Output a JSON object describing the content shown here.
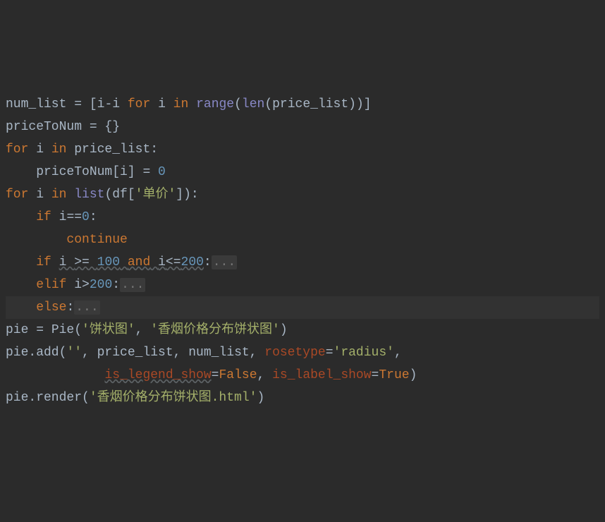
{
  "lines": {
    "l1": {
      "t1": "num_list ",
      "t2": "= [",
      "t3": "i",
      "t4": "-",
      "t5": "i ",
      "t6": "for",
      "t7": " i ",
      "t8": "in",
      "t9": " ",
      "t10": "range",
      "t11": "(",
      "t12": "len",
      "t13": "(price_list))]"
    },
    "l2": {
      "t1": "priceToNum ",
      "t2": "= {}"
    },
    "l3": {
      "t1": "for",
      "t2": " i ",
      "t3": "in",
      "t4": " price_list",
      "t5": ":"
    },
    "l4": {
      "t1": "    priceToNum[i] ",
      "t2": "= ",
      "t3": "0"
    },
    "l5": {
      "t1": "for",
      "t2": " i ",
      "t3": "in",
      "t4": " ",
      "t5": "list",
      "t6": "(df[",
      "t7": "'单价'",
      "t8": "])",
      "t9": ":"
    },
    "l6": {
      "t1": "    ",
      "t2": "if",
      "t3": " i",
      "t4": "==",
      "t5": "0",
      "t6": ":"
    },
    "l7": {
      "t1": "        ",
      "t2": "continue"
    },
    "l8": {
      "t1": "    ",
      "t2": "if",
      "t3": " ",
      "t4": "i ",
      "t5": ">= ",
      "t6": "100",
      "t7": " ",
      "t8": "and",
      "t9": " ",
      "t10": "i",
      "t11": "<=",
      "t12": "200",
      "t13": ":",
      "t14": "..."
    },
    "l9": {
      "t1": "    ",
      "t2": "elif",
      "t3": " i",
      "t4": ">",
      "t5": "200",
      "t6": ":",
      "t7": "..."
    },
    "l10": {
      "t1": "    ",
      "t2": "else",
      "t3": ":",
      "t4": "..."
    },
    "l11": {
      "t1": "pie ",
      "t2": "= Pie(",
      "t3": "'饼状图'",
      "t4": ", ",
      "t5": "'香烟价格分布饼状图'",
      "t6": ")"
    },
    "l12": {
      "t1": "pie.add(",
      "t2": "''",
      "t3": ", price_list, num_list, ",
      "t4": "rosetype",
      "t5": "=",
      "t6": "'radius'",
      "t7": ","
    },
    "l13": {
      "t1": "             ",
      "t2": "is_legend_show",
      "t3": "=",
      "t4": "False",
      "t5": ", ",
      "t6": "is_label_show",
      "t7": "=",
      "t8": "True",
      "t9": ")"
    },
    "l14": {
      "t1": "pie.render(",
      "t2": "'香烟价格分布饼状图.html'",
      "t3": ")"
    }
  }
}
